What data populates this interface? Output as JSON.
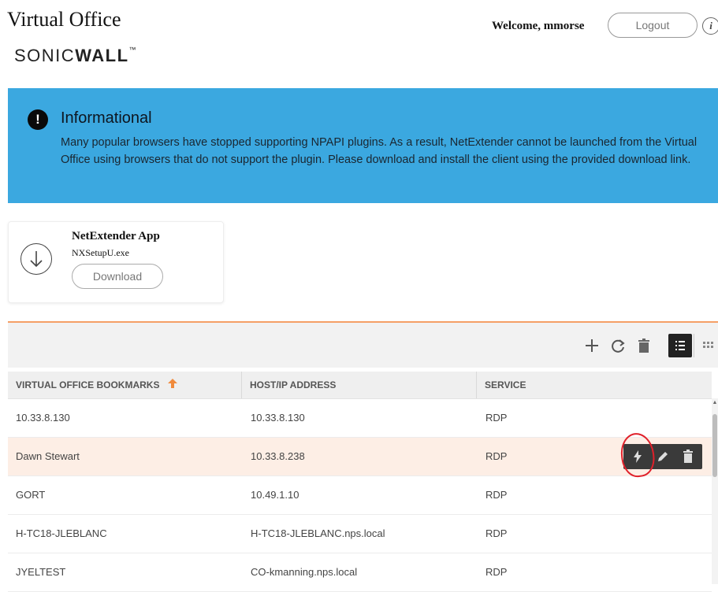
{
  "header": {
    "app_title": "Virtual Office",
    "logo": {
      "part1": "SONIC",
      "part2": "WALL",
      "tm": "™"
    },
    "welcome": "Welcome, mmorse",
    "logout_label": "Logout",
    "info_glyph": "i"
  },
  "banner": {
    "icon_glyph": "!",
    "title": "Informational",
    "message": "Many popular browsers have stopped supporting NPAPI plugins. As a result, NetExtender cannot be launched from the Virtual Office using browsers that do not support the plugin. Please download and install the client using the provided download link.",
    "background_color": "#3ba8e0"
  },
  "download": {
    "app_name": "NetExtender App",
    "file_name": "NXSetupU.exe",
    "button_label": "Download",
    "icon": "download-arrow-icon"
  },
  "toolbar": {
    "icons": [
      "add-icon",
      "refresh-icon",
      "delete-icon",
      "list-view-icon",
      "grid-view-icon"
    ],
    "active_view": "list"
  },
  "table": {
    "columns": [
      "VIRTUAL OFFICE BOOKMARKS",
      "HOST/IP ADDRESS",
      "SERVICE"
    ],
    "sort_indicator": "up-arrow-icon",
    "rows": [
      {
        "name": "10.33.8.130",
        "host": "10.33.8.130",
        "service": "RDP"
      },
      {
        "name": "Dawn Stewart",
        "host": "10.33.8.238",
        "service": "RDP"
      },
      {
        "name": "GORT",
        "host": "10.49.1.10",
        "service": "RDP"
      },
      {
        "name": "H-TC18-JLEBLANC",
        "host": "H-TC18-JLEBLANC.nps.local",
        "service": "RDP"
      },
      {
        "name": "JYELTEST",
        "host": "CO-kmanning.nps.local",
        "service": "RDP"
      }
    ],
    "highlighted_row": 1,
    "row_actions": [
      "launch-icon",
      "edit-icon",
      "delete-icon"
    ]
  },
  "colors": {
    "accent_orange": "#f5a066",
    "highlight_row": "#fdeee5",
    "annotation_red": "#e0202a"
  }
}
